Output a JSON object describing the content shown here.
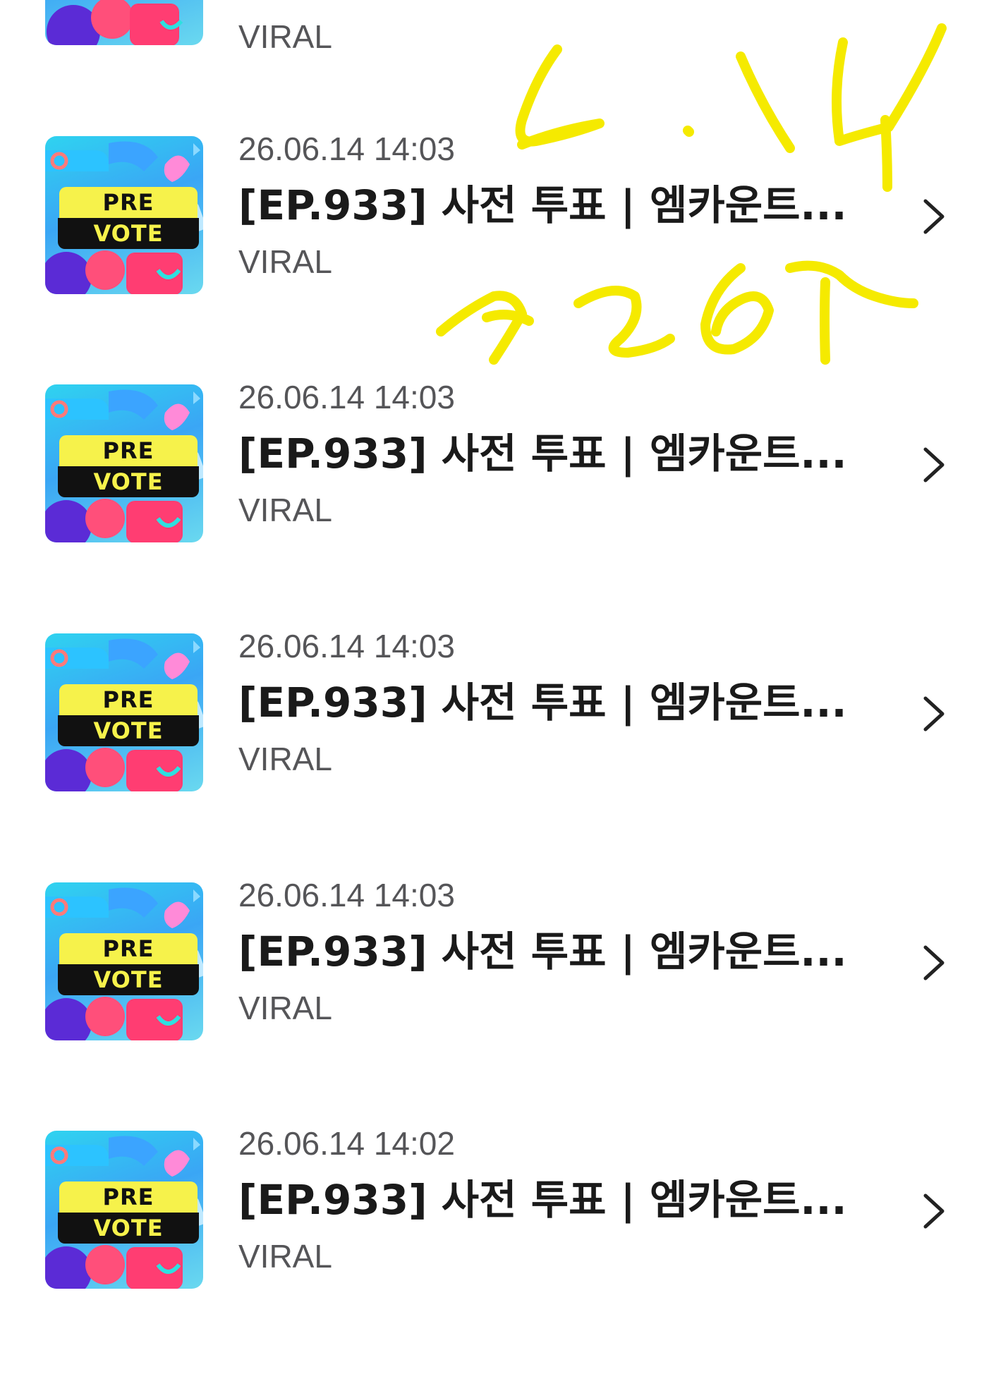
{
  "thumbnail": {
    "pre_label": "PRE",
    "vote_label": "VOTE"
  },
  "partial_item": {
    "source": "VIRAL"
  },
  "items": [
    {
      "date": "26.06.14 14:03",
      "title": "[EP.933] 사전 투표 | 엠카운트...",
      "source": "VIRAL"
    },
    {
      "date": "26.06.14 14:03",
      "title": "[EP.933] 사전 투표 | 엠카운트...",
      "source": "VIRAL"
    },
    {
      "date": "26.06.14 14:03",
      "title": "[EP.933] 사전 투표 | 엠카운트...",
      "source": "VIRAL"
    },
    {
      "date": "26.06.14 14:03",
      "title": "[EP.933] 사전 투표 | 엠카운트...",
      "source": "VIRAL"
    },
    {
      "date": "26.06.14 14:02",
      "title": "[EP.933] 사전 투표 | 엠카운트...",
      "source": "VIRAL"
    }
  ],
  "icons": {
    "row_arrow": "chevron-right-icon"
  },
  "colors": {
    "annotation": "#f5ea00",
    "date_text": "#555558",
    "title_text": "#1a1a1a",
    "pre_band": "#f6f24b",
    "vote_band": "#111111"
  }
}
